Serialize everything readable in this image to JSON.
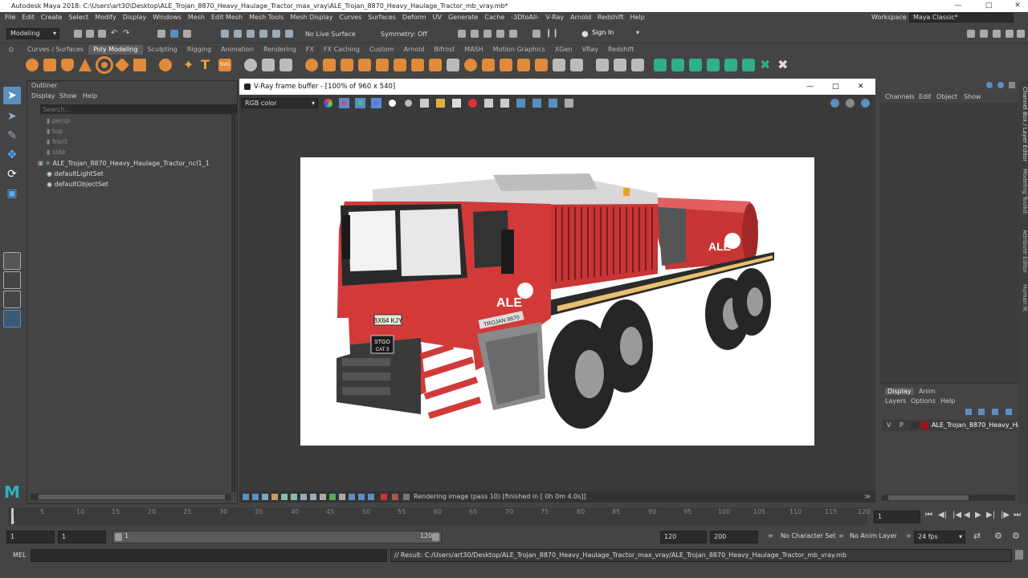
{
  "window": {
    "title": "Autodesk Maya 2018: C:\\Users\\art30\\Desktop\\ALE_Trojan_8870_Heavy_Haulage_Tractor_max_vray\\ALE_Trojan_8870_Heavy_Haulage_Tractor_mb_vray.mb*"
  },
  "menus": [
    "File",
    "Edit",
    "Create",
    "Select",
    "Modify",
    "Display",
    "Windows",
    "Mesh",
    "Edit Mesh",
    "Mesh Tools",
    "Mesh Display",
    "Curves",
    "Surfaces",
    "Deform",
    "UV",
    "Generate",
    "Cache",
    "-3DtoAll-",
    "V-Ray",
    "Arnold",
    "Redshift",
    "Help"
  ],
  "workspace": {
    "label": "Workspace :",
    "value": "Maya Classic*"
  },
  "statusline": {
    "mode": "Modeling",
    "live_surface": "No Live Surface",
    "symmetry": "Symmetry: Off",
    "sign_in": "Sign In"
  },
  "shelf_tabs": [
    "Curves / Surfaces",
    "Poly Modeling",
    "Sculpting",
    "Rigging",
    "Animation",
    "Rendering",
    "FX",
    "FX Caching",
    "Custom",
    "Arnold",
    "Bifrost",
    "MASH",
    "Motion Graphics",
    "XGen",
    "VRay",
    "Redshift"
  ],
  "shelf_active": "Poly Modeling",
  "outliner": {
    "title": "Outliner",
    "menus": [
      "Display",
      "Show",
      "Help"
    ],
    "search_placeholder": "Search...",
    "items": [
      "persp",
      "top",
      "front",
      "side",
      "ALE_Trojan_8870_Heavy_Haulage_Tractor_ncl1_1",
      "defaultLightSet",
      "defaultObjectSet"
    ]
  },
  "vray": {
    "title": "V-Ray frame buffer - [100% of 960 x 540]",
    "channel": "RGB color",
    "status": "Rendering image (pass 10) [finished in [ 0h  0m  4.0s]]"
  },
  "truck": {
    "brand": "ALE",
    "plate": "BX64 KJY",
    "model_badge": "TROJAN 8870",
    "stgo": "STGO",
    "cat": "CAT 3",
    "colors": {
      "body": "#d23a3a",
      "dark": "#2a2a2a",
      "stripe": "#e8c070"
    }
  },
  "channelbox": {
    "menus": [
      "Channels",
      "Edit",
      "Object",
      "Show"
    ]
  },
  "side_tabs": [
    "Channel Box / Layer Editor",
    "Modeling Toolkit",
    "Attribute Editor",
    "Human IK"
  ],
  "layers": {
    "tabs": [
      "Display",
      "Anim"
    ],
    "menus": [
      "Layers",
      "Options",
      "Help"
    ],
    "layer": {
      "v": "V",
      "p": "P",
      "name": "ALE_Trojan_8870_Heavy_Haulag",
      "color": "#a01020"
    }
  },
  "timeslider": {
    "ticks": [
      "5",
      "10",
      "15",
      "20",
      "25",
      "30",
      "35",
      "40",
      "45",
      "50",
      "55",
      "60",
      "65",
      "70",
      "75",
      "80",
      "85",
      "90",
      "95",
      "100",
      "105",
      "110",
      "115",
      "120"
    ],
    "current": "1",
    "start_mark": "1"
  },
  "range": {
    "start": "1",
    "playback_start": "1",
    "slider_start": "1",
    "slider_end": "120",
    "playback_end": "120",
    "end": "200",
    "character_set": "No Character Set",
    "anim_layer": "No Anim Layer",
    "fps": "24 fps"
  },
  "cmd": {
    "lang": "MEL",
    "result": "// Result: C:/Users/art30/Desktop/ALE_Trojan_8870_Heavy_Haulage_Tractor_max_vray/ALE_Trojan_8870_Heavy_Haulage_Tractor_mb_vray.mb"
  }
}
